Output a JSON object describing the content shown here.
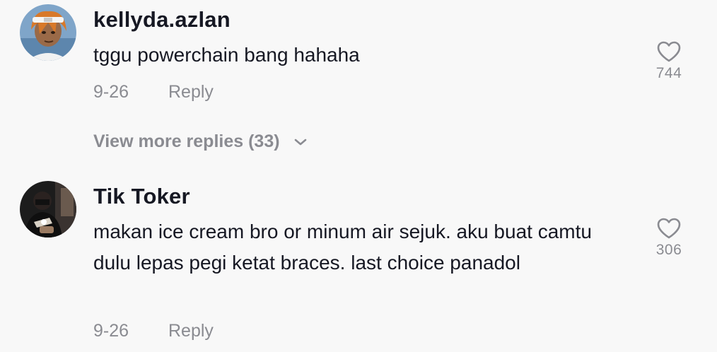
{
  "comments": [
    {
      "username": "kellyda.azlan",
      "text": "tggu powerchain bang hahaha",
      "date": "9-26",
      "reply_label": "Reply",
      "likes": "744"
    },
    {
      "username": "Tik Toker",
      "text": "makan ice cream bro or minum air sejuk. aku buat camtu dulu lepas pegi ketat braces. last choice panadol",
      "date": "9-26",
      "reply_label": "Reply",
      "likes": "306"
    }
  ],
  "view_more_replies": "View more replies (33)",
  "colors": {
    "background": "#f8f8f8",
    "primary_text": "#161823",
    "secondary_text": "#8a8b91"
  },
  "icons": [
    "heart-icon",
    "chevron-down-icon"
  ]
}
